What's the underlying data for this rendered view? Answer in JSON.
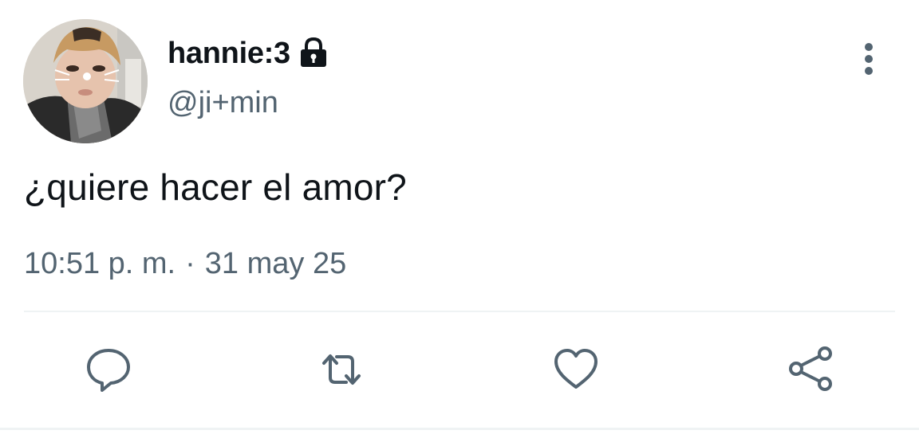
{
  "tweet": {
    "display_name": "hannie:3",
    "handle": "@ji+min",
    "text": "¿quiere hacer el amor?",
    "time": "10:51 p. m.",
    "separator": "·",
    "date": "31 may 25"
  },
  "icons": {
    "lock": "lock-icon",
    "more": "more-vertical-icon",
    "reply": "reply-icon",
    "retweet": "retweet-icon",
    "like": "heart-icon",
    "share": "share-icon"
  },
  "colors": {
    "text_primary": "#0f1419",
    "text_secondary": "#536471",
    "divider": "#eff3f4"
  }
}
